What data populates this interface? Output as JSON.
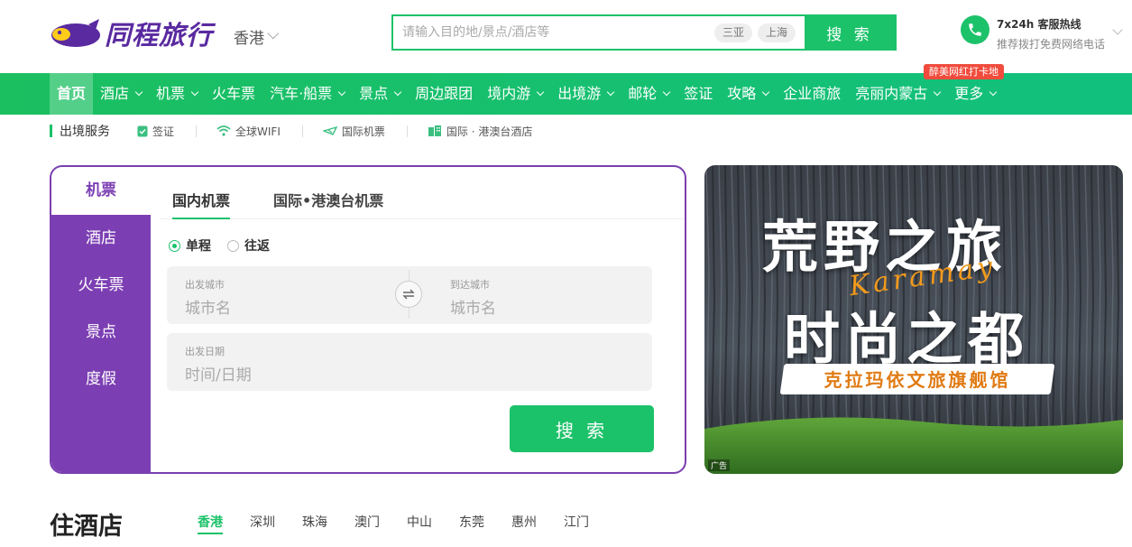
{
  "header": {
    "logo_text": "同程旅行",
    "city": "香港",
    "search": {
      "placeholder": "请输入目的地/景点/酒店等",
      "chips": [
        "三亚",
        "上海"
      ],
      "button": "搜 索"
    },
    "hotline": {
      "title": "7x24h 客服热线",
      "subtitle": "推荐拨打免费网络电话"
    }
  },
  "nav": {
    "items": [
      {
        "label": "首页",
        "dropdown": false
      },
      {
        "label": "酒店",
        "dropdown": true
      },
      {
        "label": "机票",
        "dropdown": true
      },
      {
        "label": "火车票",
        "dropdown": false
      },
      {
        "label": "汽车·船票",
        "dropdown": true
      },
      {
        "label": "景点",
        "dropdown": true
      },
      {
        "label": "周边跟团",
        "dropdown": false
      },
      {
        "label": "境内游",
        "dropdown": true
      },
      {
        "label": "出境游",
        "dropdown": true
      },
      {
        "label": "邮轮",
        "dropdown": true
      },
      {
        "label": "签证",
        "dropdown": false
      },
      {
        "label": "攻略",
        "dropdown": true
      },
      {
        "label": "企业商旅",
        "dropdown": false
      },
      {
        "label": "亮丽内蒙古",
        "dropdown": true
      },
      {
        "label": "更多",
        "dropdown": true
      }
    ],
    "promo_badge": "醉美网红打卡地"
  },
  "subnav": {
    "title": "出境服务",
    "items": [
      "签证",
      "全球WIFI",
      "国际机票",
      "国际 · 港澳台酒店"
    ]
  },
  "booking": {
    "side_tabs": [
      "机票",
      "酒店",
      "火车票",
      "景点",
      "度假"
    ],
    "tabs": [
      "国内机票",
      "国际•港澳台机票"
    ],
    "trip_types": [
      "单程",
      "往返"
    ],
    "from_label": "出发城市",
    "from_placeholder": "城市名",
    "to_label": "到达城市",
    "to_placeholder": "城市名",
    "date_label": "出发日期",
    "date_placeholder": "时间/日期",
    "search_button": "搜 索"
  },
  "banner": {
    "line1": "荒野之旅",
    "line2": "时尚之都",
    "script": "Karamay",
    "ribbon": "克拉玛依文旅旗舰馆",
    "ad_label": "广告"
  },
  "hotels": {
    "title": "住酒店",
    "cities": [
      "香港",
      "深圳",
      "珠海",
      "澳门",
      "中山",
      "东莞",
      "惠州",
      "江门"
    ]
  },
  "colors": {
    "brand_green": "#1cc26a",
    "brand_purple": "#7c3fb3",
    "promo_red": "#f04b3c"
  }
}
